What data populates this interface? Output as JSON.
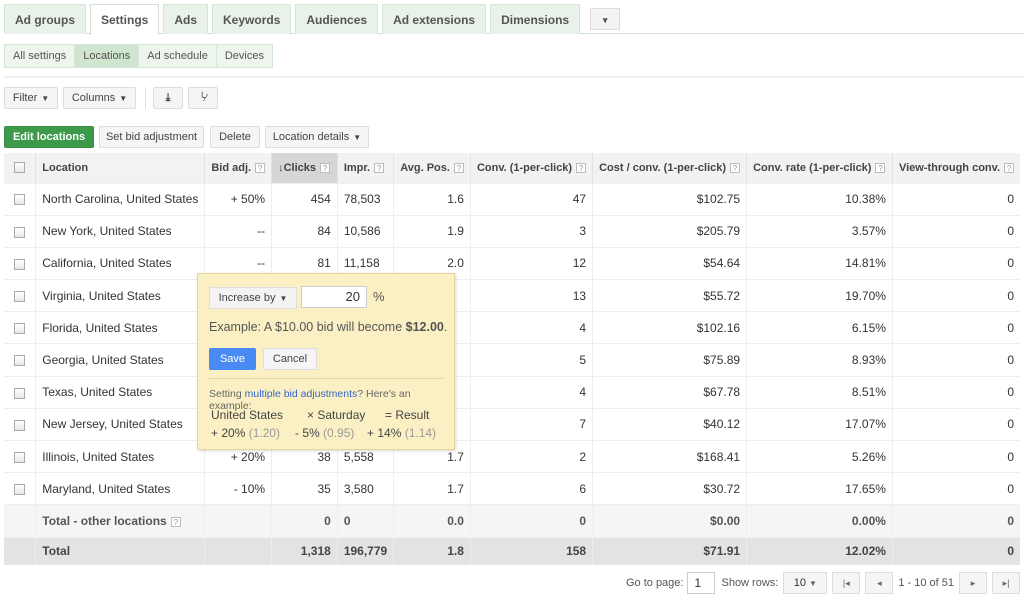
{
  "tabs": [
    {
      "label": "Ad groups",
      "active": false
    },
    {
      "label": "Settings",
      "active": true
    },
    {
      "label": "Ads",
      "active": false
    },
    {
      "label": "Keywords",
      "active": false
    },
    {
      "label": "Audiences",
      "active": false
    },
    {
      "label": "Ad extensions",
      "active": false
    },
    {
      "label": "Dimensions",
      "active": false
    }
  ],
  "tabs_more_icon": "▾",
  "subtabs": [
    {
      "label": "All settings",
      "active": false
    },
    {
      "label": "Locations",
      "active": true
    },
    {
      "label": "Ad schedule",
      "active": false
    },
    {
      "label": "Devices",
      "active": false
    }
  ],
  "toolbar": {
    "filter": "Filter",
    "columns": "Columns",
    "download_icon": "⤓",
    "chart_icon": "📈",
    "edit_locations": "Edit locations",
    "set_bid_adjustment": "Set bid adjustment",
    "delete": "Delete",
    "location_details": "Location details"
  },
  "table": {
    "headers": {
      "location": "Location",
      "bid_adj": "Bid adj.",
      "clicks": "Clicks",
      "impr": "Impr.",
      "avg_pos": "Avg. Pos.",
      "conv": "Conv. (1-per-click)",
      "cost_conv": "Cost / conv. (1-per-click)",
      "conv_rate": "Conv. rate (1-per-click)",
      "view_through": "View-through conv."
    },
    "sort_icon": "↓",
    "help_icon": "?",
    "rows": [
      {
        "location": "North Carolina, United States",
        "bid_adj": "+ 50%",
        "clicks": "454",
        "impr": "78,503",
        "avg_pos": "1.6",
        "conv": "47",
        "cost_conv": "$102.75",
        "conv_rate": "10.38%",
        "view_through": "0"
      },
      {
        "location": "New York, United States",
        "bid_adj": "--",
        "clicks": "84",
        "impr": "10,586",
        "avg_pos": "1.9",
        "conv": "3",
        "cost_conv": "$205.79",
        "conv_rate": "3.57%",
        "view_through": "0"
      },
      {
        "location": "California, United States",
        "bid_adj": "--",
        "clicks": "81",
        "impr": "11,158",
        "avg_pos": "2.0",
        "conv": "12",
        "cost_conv": "$54.64",
        "conv_rate": "14.81%",
        "view_through": "0"
      },
      {
        "location": "Virginia, United States",
        "bid_adj": "",
        "clicks": "",
        "impr": "",
        "avg_pos": "",
        "conv": "13",
        "cost_conv": "$55.72",
        "conv_rate": "19.70%",
        "view_through": "0"
      },
      {
        "location": "Florida, United States",
        "bid_adj": "",
        "clicks": "",
        "impr": "",
        "avg_pos": "",
        "conv": "4",
        "cost_conv": "$102.16",
        "conv_rate": "6.15%",
        "view_through": "0"
      },
      {
        "location": "Georgia, United States",
        "bid_adj": "",
        "clicks": "",
        "impr": "",
        "avg_pos": "",
        "conv": "5",
        "cost_conv": "$75.89",
        "conv_rate": "8.93%",
        "view_through": "0"
      },
      {
        "location": "Texas, United States",
        "bid_adj": "",
        "clicks": "",
        "impr": "",
        "avg_pos": "",
        "conv": "4",
        "cost_conv": "$67.78",
        "conv_rate": "8.51%",
        "view_through": "0"
      },
      {
        "location": "New Jersey, United States",
        "bid_adj": "",
        "clicks": "",
        "impr": "",
        "avg_pos": "",
        "conv": "7",
        "cost_conv": "$40.12",
        "conv_rate": "17.07%",
        "view_through": "0"
      },
      {
        "location": "Illinois, United States",
        "bid_adj": "+ 20%",
        "clicks": "38",
        "impr": "5,558",
        "avg_pos": "1.7",
        "conv": "2",
        "cost_conv": "$168.41",
        "conv_rate": "5.26%",
        "view_through": "0"
      },
      {
        "location": "Maryland, United States",
        "bid_adj": "- 10%",
        "clicks": "35",
        "impr": "3,580",
        "avg_pos": "1.7",
        "conv": "6",
        "cost_conv": "$30.72",
        "conv_rate": "17.65%",
        "view_through": "0"
      }
    ],
    "other": {
      "location": "Total - other locations",
      "bid_adj": "",
      "clicks": "0",
      "impr": "0",
      "avg_pos": "0.0",
      "conv": "0",
      "cost_conv": "$0.00",
      "conv_rate": "0.00%",
      "view_through": "0"
    },
    "total": {
      "location": "Total",
      "bid_adj": "",
      "clicks": "1,318",
      "impr": "196,779",
      "avg_pos": "1.8",
      "conv": "158",
      "cost_conv": "$71.91",
      "conv_rate": "12.02%",
      "view_through": "0"
    }
  },
  "popup": {
    "mode": "Increase by",
    "value": "20",
    "unit": "%",
    "example_prefix": "Example: A $10.00 bid will become ",
    "example_value": "$12.00",
    "example_suffix": ".",
    "save": "Save",
    "cancel": "Cancel",
    "multi_prefix": "Setting ",
    "multi_link": "multiple bid adjustments",
    "multi_suffix": "? Here's an example:",
    "ex_row1": [
      "United States",
      "× Saturday",
      "= Result"
    ],
    "ex_row2": [
      {
        "pct": "+ 20%",
        "factor": "(1.20)"
      },
      {
        "pct": "- 5%",
        "factor": "(0.95)"
      },
      {
        "pct": "+ 14%",
        "factor": "(1.14)"
      }
    ]
  },
  "pager": {
    "go_to_page_label": "Go to page:",
    "page": "1",
    "show_rows_label": "Show rows:",
    "rows": "10",
    "range": "1 - 10 of 51",
    "first_icon": "⏮",
    "prev_icon": "◀",
    "next_icon": "▶",
    "last_icon": "⏭"
  }
}
